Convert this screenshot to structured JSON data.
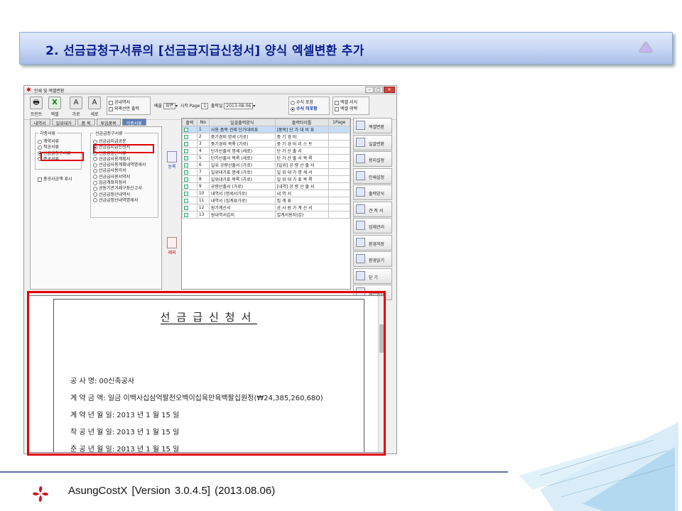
{
  "slide": {
    "title": "2. 선금급청구서류의 [선금급지급신청서] 양식 엑셀변환 추가",
    "footer": "AsungCostX   [Version 3.0.4.5]   (2013.08.06)"
  },
  "window": {
    "title": "인쇄 및 엑셀변환",
    "toolbar": {
      "print": "프린트",
      "excel": "엑셀",
      "landscape": "가로",
      "portrait": "세로",
      "opt_gongnae": "공내역서",
      "opt_outline": "외곽선만 출력",
      "zoom_label": "배율",
      "zoom_value": "화면",
      "start_page_label": "시작 Page",
      "start_page_value": "1",
      "print_date_label": "출력일",
      "print_date_value": "2013-08-06",
      "opt_formula_include": "수식 포함",
      "opt_formula_exclude": "수식 미포함",
      "opt_excel_sheet": "엑셀 서식",
      "opt_excel_sep": "엑셀 여백"
    },
    "tabs": [
      "내역서",
      "일위대가",
      "품 목",
      "투입품목",
      "각종서류"
    ],
    "left": {
      "group1_title": "각종서류",
      "group1_items": [
        "계약서류",
        "착공서류",
        "선금급청구서류",
        "준공서류"
      ],
      "group2_title": "선금급청구서류",
      "group2_items": [
        "선금급지급공문",
        "선금급지급신청서",
        "선금급정산서류",
        "선금급사용계획서",
        "선금급사용계획내역명세서",
        "선금급사용각서",
        "선금급사용서약서",
        "입금계좌지정서",
        "공동기관거래구좌신고서",
        "선금급정산내역서",
        "선금급정산내역명세서"
      ],
      "total_option": "총공사금액 표시"
    },
    "mid": {
      "register": "등록",
      "remove": "제외"
    },
    "grid": {
      "headers": [
        "출력",
        "No",
        "일괄출력양식",
        "출력타이틀",
        "1Page"
      ],
      "rows": [
        [
          "1",
          "사용 품목 견제 단가대비표",
          "[품목] 단 가 대 비 표"
        ],
        [
          "2",
          "중기경비 명세 (가로)",
          "중 기 경 비"
        ],
        [
          "3",
          "중기경비 목록 (가로)",
          "중 기 경 비 리 스 트"
        ],
        [
          "4",
          "단가산출서 명세 (세로)",
          "단 가 산 출 서"
        ],
        [
          "5",
          "단가산출서 목록 (세로)",
          "단 가 산 출 서 목 록"
        ],
        [
          "6",
          "일위 공량산출서 (가로)",
          "[일위] 공 량 산 출 서"
        ],
        [
          "7",
          "일위대가표 명세 (가로)",
          "일 위 대 가 명 세 서"
        ],
        [
          "8",
          "일위대가표 목록 (가로)",
          "일 위 대 가 표 목 록"
        ],
        [
          "9",
          "공량산출서 (가로)",
          "[내역] 공 량 산 출 서"
        ],
        [
          "10",
          "내역서 (명세서가로)",
          "내 역 서"
        ],
        [
          "11",
          "내역서 (집계표가로)",
          "집 계 표"
        ],
        [
          "12",
          "원가계산서",
          "공 사 원 가 계 산 서"
        ],
        [
          "13",
          "원내역서갑지",
          "설계서용지(갑)"
        ]
      ]
    },
    "right_buttons": [
      "엑셀변환",
      "일괄변환",
      "용지설정",
      "인쇄설정",
      "출력양식",
      "견 적 서",
      "업체관리",
      "환경저장",
      "환경읽기",
      "닫 기",
      "화면숨김"
    ]
  },
  "document": {
    "title": "선금급신청서",
    "lines": [
      "공    사    명: 00신축공사",
      "계  약  금  액: 일금 이백사십삼억팔천오백이십육만육백팔십원정(₩24,385,260,680)",
      "계 약 년 월 일: 2013 년  1 월  15 일",
      "착 공 년 월 일: 2013 년  1 월  15 일",
      "준 공 년 월 일: 2013 년  1 월  15 일"
    ]
  },
  "colors": {
    "highlight": "#e00000",
    "banner_text": "#0a1e8c"
  }
}
